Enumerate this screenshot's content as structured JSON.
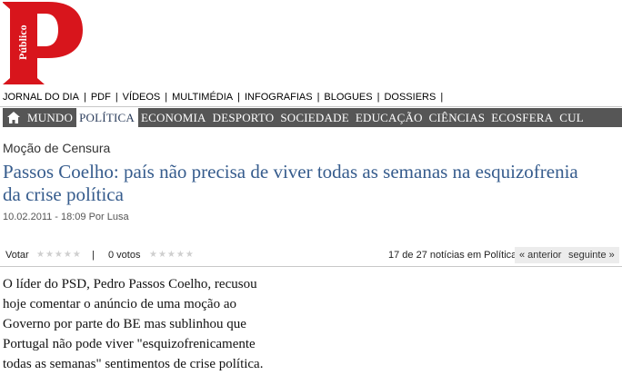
{
  "logo": {
    "text": "Público",
    "letter": "P"
  },
  "topnav": {
    "items": [
      "JORNAL DO DIA",
      "PDF",
      "VÍDEOS",
      "MULTIMÉDIA",
      "INFOGRAFIAS",
      "BLOGUES",
      "DOSSIERS"
    ],
    "separator": "|"
  },
  "sections": {
    "home_icon": "home-icon",
    "items": [
      "MUNDO",
      "POLÍTICA",
      "ECONOMIA",
      "DESPORTO",
      "SOCIEDADE",
      "EDUCAÇÃO",
      "CIÊNCIAS",
      "ECOSFERA",
      "CUL"
    ],
    "active": "POLÍTICA"
  },
  "article": {
    "kicker": "Moção de Censura",
    "headline": "Passos Coelho: país não precisa de viver todas as semanas na esquizofrenia da crise política",
    "byline": "10.02.2011 - 18:09 Por Lusa",
    "body": "O líder do PSD, Pedro Passos Coelho, recusou hoje comentar o anúncio de uma moção ao Governo por parte do BE mas sublinhou que Portugal não pode viver \"esquizofrenicamente todas as semanas\" sentimentos de crise política."
  },
  "votebar": {
    "vote_label": "Votar",
    "stars": "★★★★★",
    "separator": "|",
    "votes": "0 votos",
    "position": "17 de 27 notícias em Política",
    "prev": "« anterior",
    "next": "seguinte »"
  },
  "colors": {
    "brand_red": "#d8151c",
    "headline_blue": "#365c8d",
    "section_bar": "#565656"
  }
}
